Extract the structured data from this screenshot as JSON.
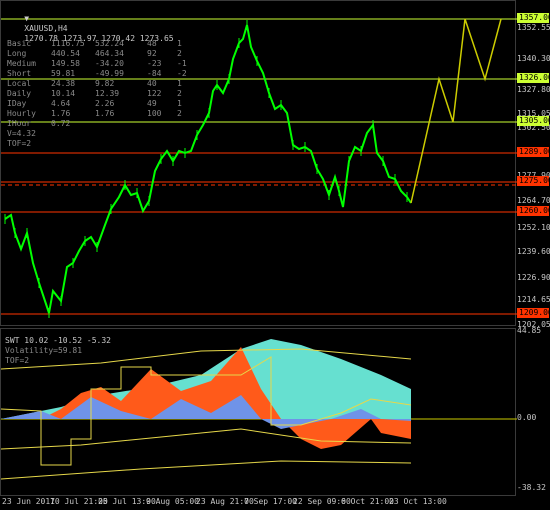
{
  "header": {
    "symbol": "XAUUSD,H4",
    "ohlc": "1270.78 1273.97 1270.42 1273.65"
  },
  "stats": [
    {
      "label": "Basic",
      "a": "1116.75",
      "b": "532.24",
      "c": "48",
      "d": "1"
    },
    {
      "label": "Long",
      "a": "440.54",
      "b": "464.34",
      "c": "92",
      "d": "2"
    },
    {
      "label": "Medium",
      "a": "149.58",
      "b": "-34.20",
      "c": "-23",
      "d": "-1"
    },
    {
      "label": "Short",
      "a": "59.81",
      "b": "-49.99",
      "c": "-84",
      "d": "-2"
    },
    {
      "label": "Local",
      "a": "24.38",
      "b": "9.82",
      "c": "40",
      "d": "1"
    },
    {
      "label": "Daily",
      "a": "10.14",
      "b": "12.39",
      "c": "122",
      "d": "2"
    },
    {
      "label": "IDay",
      "a": "4.64",
      "b": "2.26",
      "c": "49",
      "d": "1"
    },
    {
      "label": "Hourly",
      "a": "1.76",
      "b": "1.76",
      "c": "100",
      "d": "2"
    },
    {
      "label": "IHour",
      "a": "0.72",
      "b": "",
      "c": "",
      "d": ""
    }
  ],
  "extra_lines": [
    "V=4.32",
    "TOF=2"
  ],
  "price_axis": [
    "1352.55",
    "1340.30",
    "1327.80",
    "1315.05",
    "1302.50",
    "1277.90",
    "1264.70",
    "1252.10",
    "1239.60",
    "1226.90",
    "1214.65",
    "1202.05"
  ],
  "price_levels": [
    {
      "value": "1357.00",
      "color": "#ccff33"
    },
    {
      "value": "1326.00",
      "color": "#ccff33"
    },
    {
      "value": "1305.00",
      "color": "#ccff33"
    },
    {
      "value": "1289.00",
      "color": "#ff3300"
    },
    {
      "value": "1275.00",
      "color": "#ff3300"
    },
    {
      "value": "1260.00",
      "color": "#ff3300"
    },
    {
      "value": "1209.00",
      "color": "#ff3300"
    }
  ],
  "osc": {
    "title": "SWT 10.02 -10.52 -5.32",
    "volatility": "Volatility=59.81",
    "tof": "TOF=2",
    "axis": [
      "44.85",
      "0.00",
      "-38.32"
    ]
  },
  "time_axis": [
    "23 Jun 2017",
    "10 Jul 21:00",
    "25 Jul 13:00",
    "9 Aug 05:00",
    "23 Aug 21:00",
    "7 Sep 17:00",
    "22 Sep 09:00",
    "6 Oct 21:00",
    "23 Oct 13:00"
  ],
  "colors": {
    "candle": "#00ff00",
    "forecast": "#cccc00",
    "support": "#ff3300",
    "resistance": "#ccff33",
    "cyan": "#66e0d0",
    "orange": "#ff5a1a",
    "blue": "#6f93e8"
  }
}
